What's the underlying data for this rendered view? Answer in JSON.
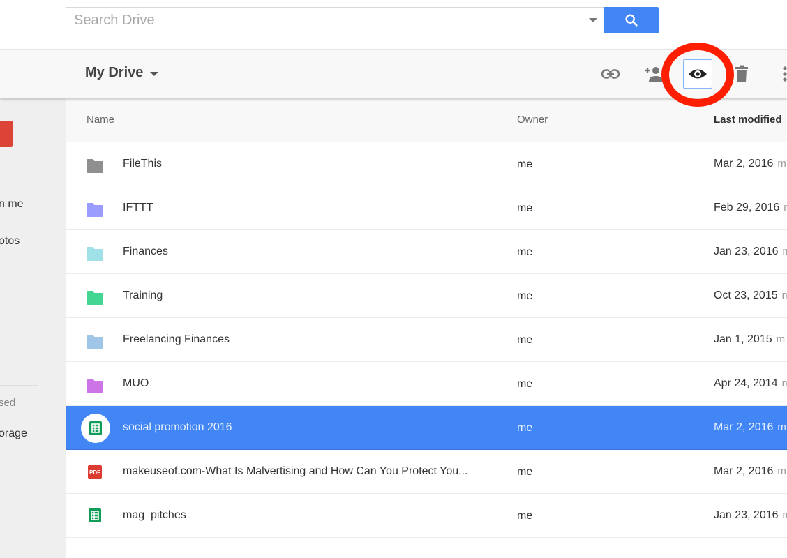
{
  "search": {
    "placeholder": "Search Drive",
    "value": ""
  },
  "toolbar": {
    "title": "My Drive",
    "actions": [
      {
        "name": "get-link",
        "icon": "link-icon"
      },
      {
        "name": "share",
        "icon": "add-person-icon"
      },
      {
        "name": "preview",
        "icon": "eye-icon",
        "highlighted": true
      },
      {
        "name": "remove",
        "icon": "trash-icon"
      },
      {
        "name": "more",
        "icon": "more-vert-icon"
      }
    ]
  },
  "sidebar": {
    "new_label": "",
    "items": [
      {
        "label": "n me"
      },
      {
        "label": "otos"
      }
    ],
    "storage_used": "sed",
    "storage_link": "orage"
  },
  "table": {
    "headers": {
      "name": "Name",
      "owner": "Owner",
      "modified": "Last modified"
    },
    "rows": [
      {
        "name": "FileThis",
        "type": "folder",
        "color": "#8f8f8f",
        "owner": "me",
        "modified": "Mar 2, 2016",
        "modified_by": "m"
      },
      {
        "name": "IFTTT",
        "type": "folder",
        "color": "#9a9cff",
        "owner": "me",
        "modified": "Feb 29, 2016",
        "modified_by": "m"
      },
      {
        "name": "Finances",
        "type": "folder",
        "color": "#9fe1e7",
        "owner": "me",
        "modified": "Jan 23, 2016",
        "modified_by": "m"
      },
      {
        "name": "Training",
        "type": "folder",
        "color": "#42d692",
        "owner": "me",
        "modified": "Oct 23, 2015",
        "modified_by": "m"
      },
      {
        "name": "Freelancing Finances",
        "type": "folder",
        "color": "#9fc6e7",
        "owner": "me",
        "modified": "Jan 1, 2015",
        "modified_by": "m"
      },
      {
        "name": "MUO",
        "type": "folder",
        "color": "#cd74e6",
        "owner": "me",
        "modified": "Apr 24, 2014",
        "modified_by": "m"
      },
      {
        "name": "social promotion 2016",
        "type": "sheet",
        "owner": "me",
        "modified": "Mar 2, 2016",
        "modified_by": "m",
        "selected": true
      },
      {
        "name": "makeuseof.com-What Is Malvertising and How Can You Protect You...",
        "type": "pdf",
        "owner": "me",
        "modified": "Mar 2, 2016",
        "modified_by": "m"
      },
      {
        "name": "mag_pitches",
        "type": "sheet",
        "owner": "me",
        "modified": "Jan 23, 2016",
        "modified_by": "m"
      }
    ]
  },
  "colors": {
    "accent": "#4285f4",
    "new_button": "#db4437",
    "highlight_ring": "#ff1e00",
    "sheets_green": "#0f9d58",
    "pdf_red": "#dc3b31"
  },
  "icons": {
    "pdf_label": "PDF"
  }
}
